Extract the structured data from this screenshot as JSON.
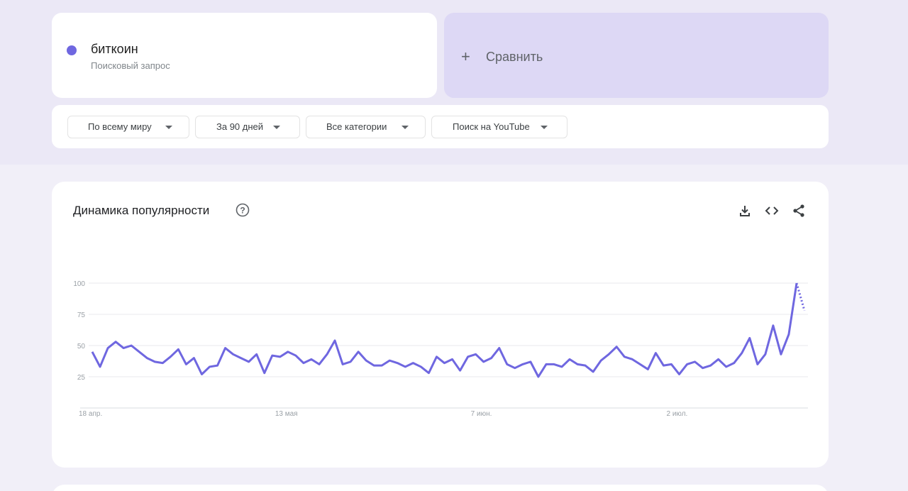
{
  "search_term": {
    "name": "биткоин",
    "type": "Поисковый запрос",
    "color": "#6f67e0"
  },
  "compare": {
    "icon": "plus-icon",
    "label": "Сравнить"
  },
  "filters": [
    {
      "label": "По всему миру"
    },
    {
      "label": "За 90 дней"
    },
    {
      "label": "Все категории"
    },
    {
      "label": "Поиск на YouTube"
    }
  ],
  "chart_panel": {
    "title": "Динамика популярности",
    "help_icon": "help-circle-icon",
    "tools": [
      "download-icon",
      "embed-code-icon",
      "share-icon"
    ]
  },
  "chart_data": {
    "type": "line",
    "ylim": [
      0,
      100
    ],
    "yticks": [
      "25",
      "50",
      "75",
      "100"
    ],
    "x_tick_labels": [
      {
        "label": "18 апр.",
        "index": 0
      },
      {
        "label": "13 мая",
        "index": 25
      },
      {
        "label": "7 июн.",
        "index": 50
      },
      {
        "label": "2 июл.",
        "index": 75
      }
    ],
    "series": [
      {
        "color": "#6f67e0",
        "values": [
          45,
          33,
          48,
          53,
          48,
          50,
          45,
          40,
          37,
          36,
          41,
          47,
          35,
          40,
          27,
          33,
          34,
          48,
          43,
          40,
          37,
          43,
          28,
          42,
          41,
          45,
          42,
          36,
          39,
          35,
          43,
          54,
          35,
          37,
          45,
          38,
          34,
          34,
          38,
          36,
          33,
          36,
          33,
          28,
          41,
          36,
          39,
          30,
          41,
          43,
          37,
          40,
          48,
          35,
          32,
          35,
          37,
          25,
          35,
          35,
          33,
          39,
          35,
          34,
          29,
          38,
          43,
          49,
          41,
          39,
          35,
          31,
          44,
          34,
          35,
          27,
          35,
          37,
          32,
          34,
          39,
          33,
          36,
          44,
          56,
          35,
          43,
          66,
          43,
          59,
          100
        ],
        "partial_values": [
          100,
          78
        ]
      }
    ],
    "grid": true
  }
}
